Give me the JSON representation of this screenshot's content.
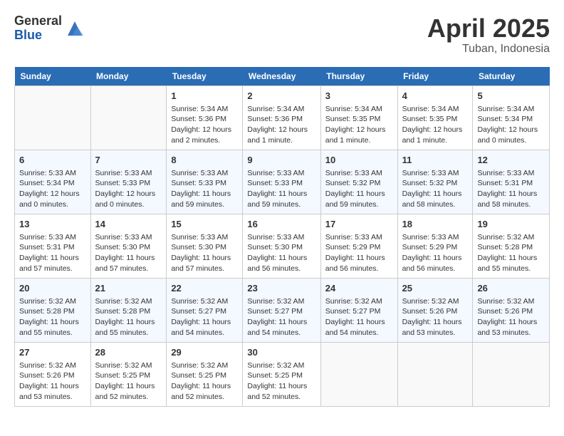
{
  "header": {
    "logo_general": "General",
    "logo_blue": "Blue",
    "month_title": "April 2025",
    "location": "Tuban, Indonesia"
  },
  "days_of_week": [
    "Sunday",
    "Monday",
    "Tuesday",
    "Wednesday",
    "Thursday",
    "Friday",
    "Saturday"
  ],
  "weeks": [
    [
      {
        "day": "",
        "info": ""
      },
      {
        "day": "",
        "info": ""
      },
      {
        "day": "1",
        "info": "Sunrise: 5:34 AM\nSunset: 5:36 PM\nDaylight: 12 hours and 2 minutes."
      },
      {
        "day": "2",
        "info": "Sunrise: 5:34 AM\nSunset: 5:36 PM\nDaylight: 12 hours and 1 minute."
      },
      {
        "day": "3",
        "info": "Sunrise: 5:34 AM\nSunset: 5:35 PM\nDaylight: 12 hours and 1 minute."
      },
      {
        "day": "4",
        "info": "Sunrise: 5:34 AM\nSunset: 5:35 PM\nDaylight: 12 hours and 1 minute."
      },
      {
        "day": "5",
        "info": "Sunrise: 5:34 AM\nSunset: 5:34 PM\nDaylight: 12 hours and 0 minutes."
      }
    ],
    [
      {
        "day": "6",
        "info": "Sunrise: 5:33 AM\nSunset: 5:34 PM\nDaylight: 12 hours and 0 minutes."
      },
      {
        "day": "7",
        "info": "Sunrise: 5:33 AM\nSunset: 5:33 PM\nDaylight: 12 hours and 0 minutes."
      },
      {
        "day": "8",
        "info": "Sunrise: 5:33 AM\nSunset: 5:33 PM\nDaylight: 11 hours and 59 minutes."
      },
      {
        "day": "9",
        "info": "Sunrise: 5:33 AM\nSunset: 5:33 PM\nDaylight: 11 hours and 59 minutes."
      },
      {
        "day": "10",
        "info": "Sunrise: 5:33 AM\nSunset: 5:32 PM\nDaylight: 11 hours and 59 minutes."
      },
      {
        "day": "11",
        "info": "Sunrise: 5:33 AM\nSunset: 5:32 PM\nDaylight: 11 hours and 58 minutes."
      },
      {
        "day": "12",
        "info": "Sunrise: 5:33 AM\nSunset: 5:31 PM\nDaylight: 11 hours and 58 minutes."
      }
    ],
    [
      {
        "day": "13",
        "info": "Sunrise: 5:33 AM\nSunset: 5:31 PM\nDaylight: 11 hours and 57 minutes."
      },
      {
        "day": "14",
        "info": "Sunrise: 5:33 AM\nSunset: 5:30 PM\nDaylight: 11 hours and 57 minutes."
      },
      {
        "day": "15",
        "info": "Sunrise: 5:33 AM\nSunset: 5:30 PM\nDaylight: 11 hours and 57 minutes."
      },
      {
        "day": "16",
        "info": "Sunrise: 5:33 AM\nSunset: 5:30 PM\nDaylight: 11 hours and 56 minutes."
      },
      {
        "day": "17",
        "info": "Sunrise: 5:33 AM\nSunset: 5:29 PM\nDaylight: 11 hours and 56 minutes."
      },
      {
        "day": "18",
        "info": "Sunrise: 5:33 AM\nSunset: 5:29 PM\nDaylight: 11 hours and 56 minutes."
      },
      {
        "day": "19",
        "info": "Sunrise: 5:32 AM\nSunset: 5:28 PM\nDaylight: 11 hours and 55 minutes."
      }
    ],
    [
      {
        "day": "20",
        "info": "Sunrise: 5:32 AM\nSunset: 5:28 PM\nDaylight: 11 hours and 55 minutes."
      },
      {
        "day": "21",
        "info": "Sunrise: 5:32 AM\nSunset: 5:28 PM\nDaylight: 11 hours and 55 minutes."
      },
      {
        "day": "22",
        "info": "Sunrise: 5:32 AM\nSunset: 5:27 PM\nDaylight: 11 hours and 54 minutes."
      },
      {
        "day": "23",
        "info": "Sunrise: 5:32 AM\nSunset: 5:27 PM\nDaylight: 11 hours and 54 minutes."
      },
      {
        "day": "24",
        "info": "Sunrise: 5:32 AM\nSunset: 5:27 PM\nDaylight: 11 hours and 54 minutes."
      },
      {
        "day": "25",
        "info": "Sunrise: 5:32 AM\nSunset: 5:26 PM\nDaylight: 11 hours and 53 minutes."
      },
      {
        "day": "26",
        "info": "Sunrise: 5:32 AM\nSunset: 5:26 PM\nDaylight: 11 hours and 53 minutes."
      }
    ],
    [
      {
        "day": "27",
        "info": "Sunrise: 5:32 AM\nSunset: 5:26 PM\nDaylight: 11 hours and 53 minutes."
      },
      {
        "day": "28",
        "info": "Sunrise: 5:32 AM\nSunset: 5:25 PM\nDaylight: 11 hours and 52 minutes."
      },
      {
        "day": "29",
        "info": "Sunrise: 5:32 AM\nSunset: 5:25 PM\nDaylight: 11 hours and 52 minutes."
      },
      {
        "day": "30",
        "info": "Sunrise: 5:32 AM\nSunset: 5:25 PM\nDaylight: 11 hours and 52 minutes."
      },
      {
        "day": "",
        "info": ""
      },
      {
        "day": "",
        "info": ""
      },
      {
        "day": "",
        "info": ""
      }
    ]
  ]
}
